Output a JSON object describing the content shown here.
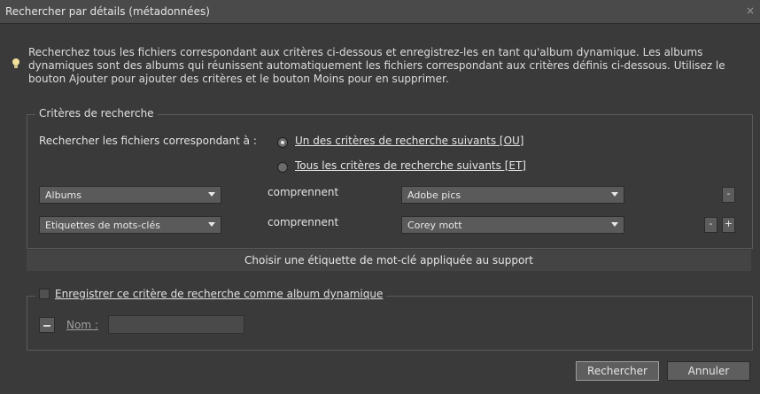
{
  "window": {
    "title": "Rechercher par détails (métadonnées)",
    "close_symbol": "×"
  },
  "info": {
    "icon": "lightbulb-icon",
    "text": "Recherchez tous les fichiers correspondant aux critères ci-dessous et enregistrez-les en tant qu'album dynamique. Les albums dynamiques sont des albums qui réunissent automatiquement les fichiers correspondant aux critères définis ci-dessous. Utilisez le bouton Ajouter pour ajouter des critères et le bouton Moins pour en supprimer."
  },
  "criteria": {
    "legend": "Critères de recherche",
    "match_label": "Rechercher les fichiers correspondant à :",
    "options": [
      {
        "label": "Un des critères de recherche suivants [OU]",
        "checked": true
      },
      {
        "label": "Tous les critères de recherche suivants [ET]",
        "checked": false
      }
    ],
    "rows": [
      {
        "field": "Albums",
        "operator": "comprennent",
        "value": "Adobe pics",
        "buttons": [
          "-"
        ]
      },
      {
        "field": "Etiquettes de mots-clés",
        "operator": "comprennent",
        "value": "Corey mott",
        "buttons": [
          "-",
          "+"
        ]
      }
    ]
  },
  "hint": "Choisir une étiquette de mot-clé appliquée au support",
  "save": {
    "label": "Enregistrer ce critère de recherche comme album dynamique",
    "name_label": "Nom :",
    "name_value": ""
  },
  "buttons": {
    "search": "Rechercher",
    "cancel": "Annuler"
  }
}
